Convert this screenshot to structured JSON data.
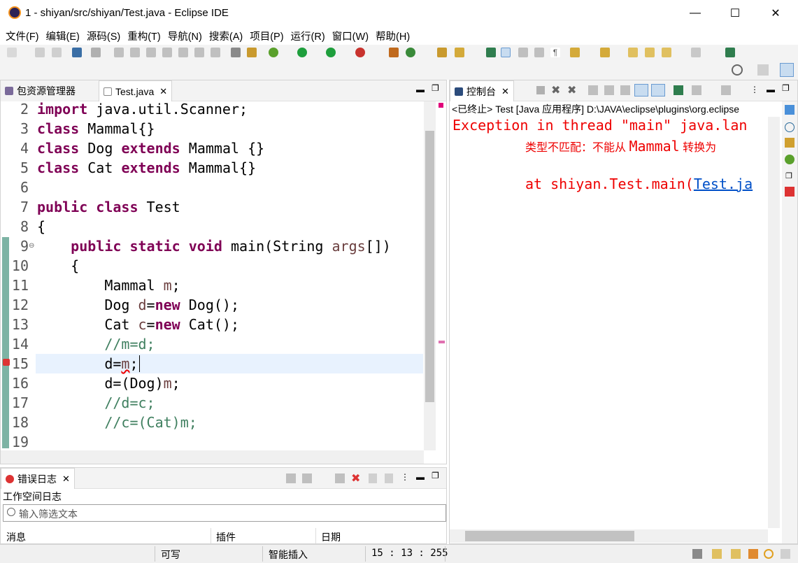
{
  "window": {
    "title": "1 - shiyan/src/shiyan/Test.java - Eclipse IDE",
    "minimize": "—",
    "maximize": "☐",
    "close": "✕"
  },
  "menu": [
    "文件(F)",
    "编辑(E)",
    "源码(S)",
    "重构(T)",
    "导航(N)",
    "搜索(A)",
    "项目(P)",
    "运行(R)",
    "窗口(W)",
    "帮助(H)"
  ],
  "package_explorer": {
    "label": "包资源管理器"
  },
  "editor": {
    "tab_label": "Test.java",
    "line_numbers": [
      "2",
      "3",
      "4",
      "5",
      "6",
      "7",
      "8",
      "9",
      "10",
      "11",
      "12",
      "13",
      "14",
      "15",
      "16",
      "17",
      "18",
      "19"
    ],
    "lines": {
      "l2": {
        "kw": "import",
        "rest": " java.util.Scanner;"
      },
      "l3": {
        "kw": "class",
        "rest": " Mammal{}"
      },
      "l4": {
        "kw1": "class",
        "mid": " Dog ",
        "kw2": "extends",
        "rest": " Mammal {}"
      },
      "l5": {
        "kw1": "class",
        "mid": " Cat ",
        "kw2": "extends",
        "rest": " Mammal{}"
      },
      "l7": {
        "kw1": "public",
        "kw2": "class",
        "rest": " Test"
      },
      "l8": "{",
      "l9": {
        "indent": "    ",
        "kw1": "public",
        "kw2": "static",
        "kw3": "void",
        "mid": " main(String ",
        "var": "args",
        "rest": "[])"
      },
      "l10": "    {",
      "l11": {
        "indent": "        ",
        "type": "Mammal ",
        "var": "m",
        "rest": ";"
      },
      "l12": {
        "indent": "        ",
        "type": "Dog ",
        "var": "d",
        "eq": "=",
        "kw": "new",
        "rest": " Dog();"
      },
      "l13": {
        "indent": "        ",
        "type": "Cat ",
        "var": "c",
        "eq": "=",
        "kw": "new",
        "rest": " Cat();"
      },
      "l14": "        //m=d;",
      "l15": {
        "indent": "        ",
        "a": "d",
        "eq": "=",
        "b": "m",
        "rest": ";"
      },
      "l16": {
        "indent": "        ",
        "a": "d",
        "mid": "=(Dog)",
        "b": "m",
        "rest": ";"
      },
      "l17": "        //d=c;",
      "l18": "        //c=(Cat)m;"
    }
  },
  "console": {
    "tab_label": "控制台",
    "header": "<已终止> Test [Java 应用程序] D:\\JAVA\\eclipse\\plugins\\org.eclipse",
    "line1": "Exception in thread \"main\" java.lan",
    "line2_a": "类型不匹配：不能从 ",
    "line2_b": "Mammal",
    "line2_c": " 转换为",
    "line3_a": "at shiyan.Test.main(",
    "line3_link": "Test.ja"
  },
  "error_log": {
    "tab_label": "错误日志",
    "subtitle": "工作空间日志",
    "filter_placeholder": "输入筛选文本",
    "columns": [
      "消息",
      "插件",
      "日期"
    ]
  },
  "status": {
    "writable": "可写",
    "insert_mode": "智能插入",
    "position": "15 : 13 : 255"
  },
  "colors": {
    "keyword": "#7f0055",
    "comment": "#3f7f5f",
    "error": "#e00000",
    "link": "#0000ee"
  }
}
